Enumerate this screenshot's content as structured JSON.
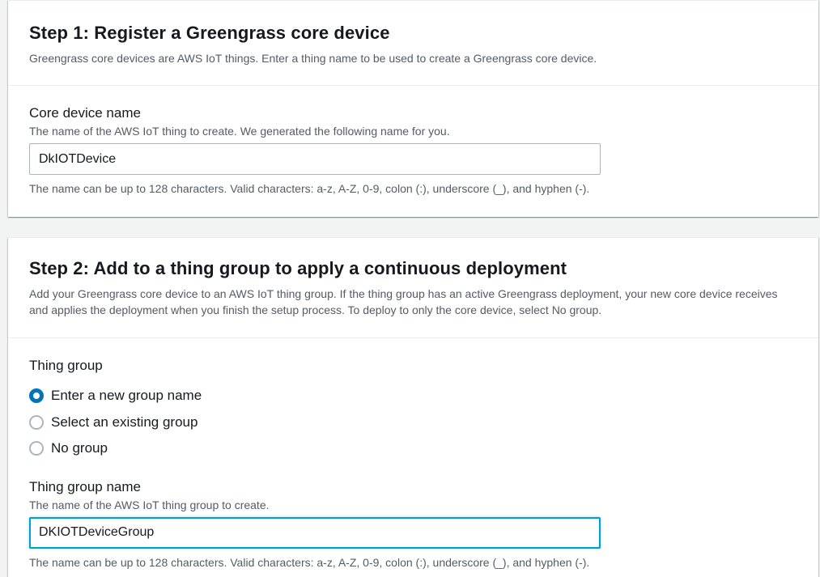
{
  "step1": {
    "title": "Step 1: Register a Greengrass core device",
    "description": "Greengrass core devices are AWS IoT things. Enter a thing name to be used to create a Greengrass core device.",
    "core_device_name": {
      "label": "Core device name",
      "description": "The name of the AWS IoT thing to create. We generated the following name for you.",
      "value": "DkIOTDevice",
      "constraint": "The name can be up to 128 characters. Valid characters: a-z, A-Z, 0-9, colon (:), underscore (_), and hyphen (-)."
    }
  },
  "step2": {
    "title": "Step 2: Add to a thing group to apply a continuous deployment",
    "description": "Add your Greengrass core device to an AWS IoT thing group. If the thing group has an active Greengrass deployment, your new core device receives and applies the deployment when you finish the setup process. To deploy to only the core device, select No group.",
    "thing_group": {
      "label": "Thing group",
      "options": [
        {
          "label": "Enter a new group name",
          "checked": true
        },
        {
          "label": "Select an existing group",
          "checked": false
        },
        {
          "label": "No group",
          "checked": false
        }
      ]
    },
    "thing_group_name": {
      "label": "Thing group name",
      "description": "The name of the AWS IoT thing group to create.",
      "value": "DKIOTDeviceGroup",
      "constraint": "The name can be up to 128 characters. Valid characters: a-z, A-Z, 0-9, colon (:), underscore (_), and hyphen (-)."
    }
  },
  "colors": {
    "accent": "#0073bb",
    "focus": "#00a1c9",
    "background": "#f2f3f3"
  }
}
